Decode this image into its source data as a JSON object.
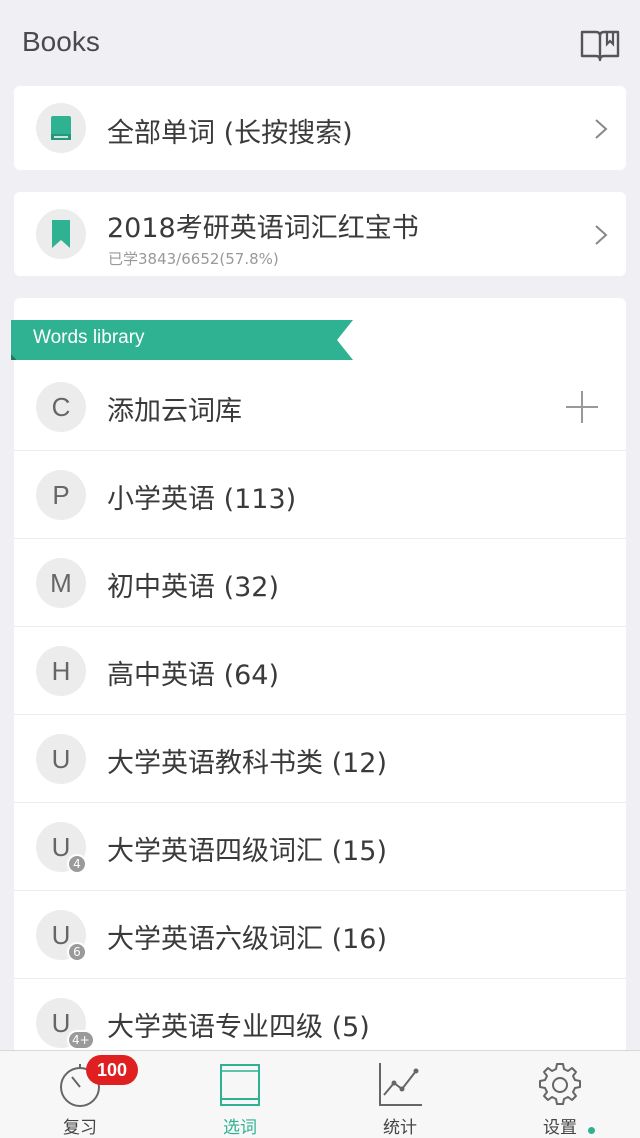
{
  "header": {
    "title": "Books",
    "icon": "open-book-icon"
  },
  "all_words": {
    "title": "全部单词 (长按搜索)",
    "icon": "book-icon"
  },
  "current_book": {
    "title": "2018考研英语词汇红宝书",
    "progress_text": "已学3843/6652(57.8%)",
    "progress_fraction": 0.578,
    "icon": "bookmark-icon"
  },
  "library": {
    "ribbon_label": "Words library",
    "items": [
      {
        "letter": "C",
        "label": "添加云词库",
        "badge": "",
        "has_plus": true
      },
      {
        "letter": "P",
        "label": "小学英语 (113)",
        "badge": ""
      },
      {
        "letter": "M",
        "label": "初中英语 (32)",
        "badge": ""
      },
      {
        "letter": "H",
        "label": "高中英语 (64)",
        "badge": ""
      },
      {
        "letter": "U",
        "label": "大学英语教科书类 (12)",
        "badge": ""
      },
      {
        "letter": "U",
        "label": "大学英语四级词汇 (15)",
        "badge": "4"
      },
      {
        "letter": "U",
        "label": "大学英语六级词汇 (16)",
        "badge": "6"
      },
      {
        "letter": "U",
        "label": "大学英语专业四级 (5)",
        "badge": "4+"
      }
    ]
  },
  "tabbar": {
    "tabs": [
      {
        "label": "复习",
        "icon": "timer-icon",
        "badge": "100"
      },
      {
        "label": "选词",
        "icon": "book-icon",
        "active": true
      },
      {
        "label": "统计",
        "icon": "line-chart-icon"
      },
      {
        "label": "设置",
        "icon": "gear-icon",
        "has_dot": true
      }
    ]
  },
  "colors": {
    "accent": "#2fb291",
    "badge": "#e02020",
    "background": "#efeff4"
  }
}
